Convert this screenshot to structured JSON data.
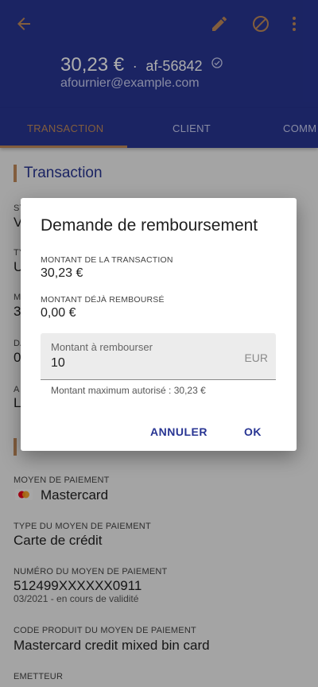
{
  "header": {
    "amount": "30,23 €",
    "separator": "·",
    "id": "af-56842",
    "email": "afournier@example.com"
  },
  "tabs": [
    {
      "label": "TRANSACTION",
      "active": true
    },
    {
      "label": "CLIENT",
      "active": false
    },
    {
      "label": "COMM",
      "active": false
    }
  ],
  "section": {
    "transaction_title": "Transaction",
    "partial_labels": [
      "ST",
      "TY",
      "M",
      "DA",
      "A"
    ],
    "partial_values": [
      "V",
      "U",
      "3",
      "0",
      "L"
    ]
  },
  "payment": {
    "method_label": "MOYEN DE PAIEMENT",
    "method_value": "Mastercard",
    "type_label": "TYPE DU MOYEN DE PAIEMENT",
    "type_value": "Carte de crédit",
    "number_label": "NUMÉRO DU MOYEN DE PAIEMENT",
    "number_value": "512499XXXXXX0911",
    "number_sub": "03/2021 - en cours de validité",
    "code_label": "CODE PRODUIT DU MOYEN DE PAIEMENT",
    "code_value": "Mastercard credit mixed bin card",
    "issuer_label": "EMETTEUR"
  },
  "dialog": {
    "title": "Demande de remboursement",
    "amount_label": "MONTANT DE LA TRANSACTION",
    "amount_value": "30,23 €",
    "refunded_label": "MONTANT DÉJÀ REMBOURSÉ",
    "refunded_value": "0,00 €",
    "field_label": "Montant à rembourser",
    "field_value": "10",
    "field_suffix": "EUR",
    "helper": "Montant maximum autorisé : 30,23 €",
    "cancel": "ANNULER",
    "ok": "OK"
  },
  "colors": {
    "primary": "#283593",
    "accent": "#c08a5a"
  },
  "icons": [
    "arrow-back-icon",
    "edit-pencil-icon",
    "block-icon",
    "more-vert-icon",
    "check-circle-icon",
    "mastercard-icon"
  ]
}
